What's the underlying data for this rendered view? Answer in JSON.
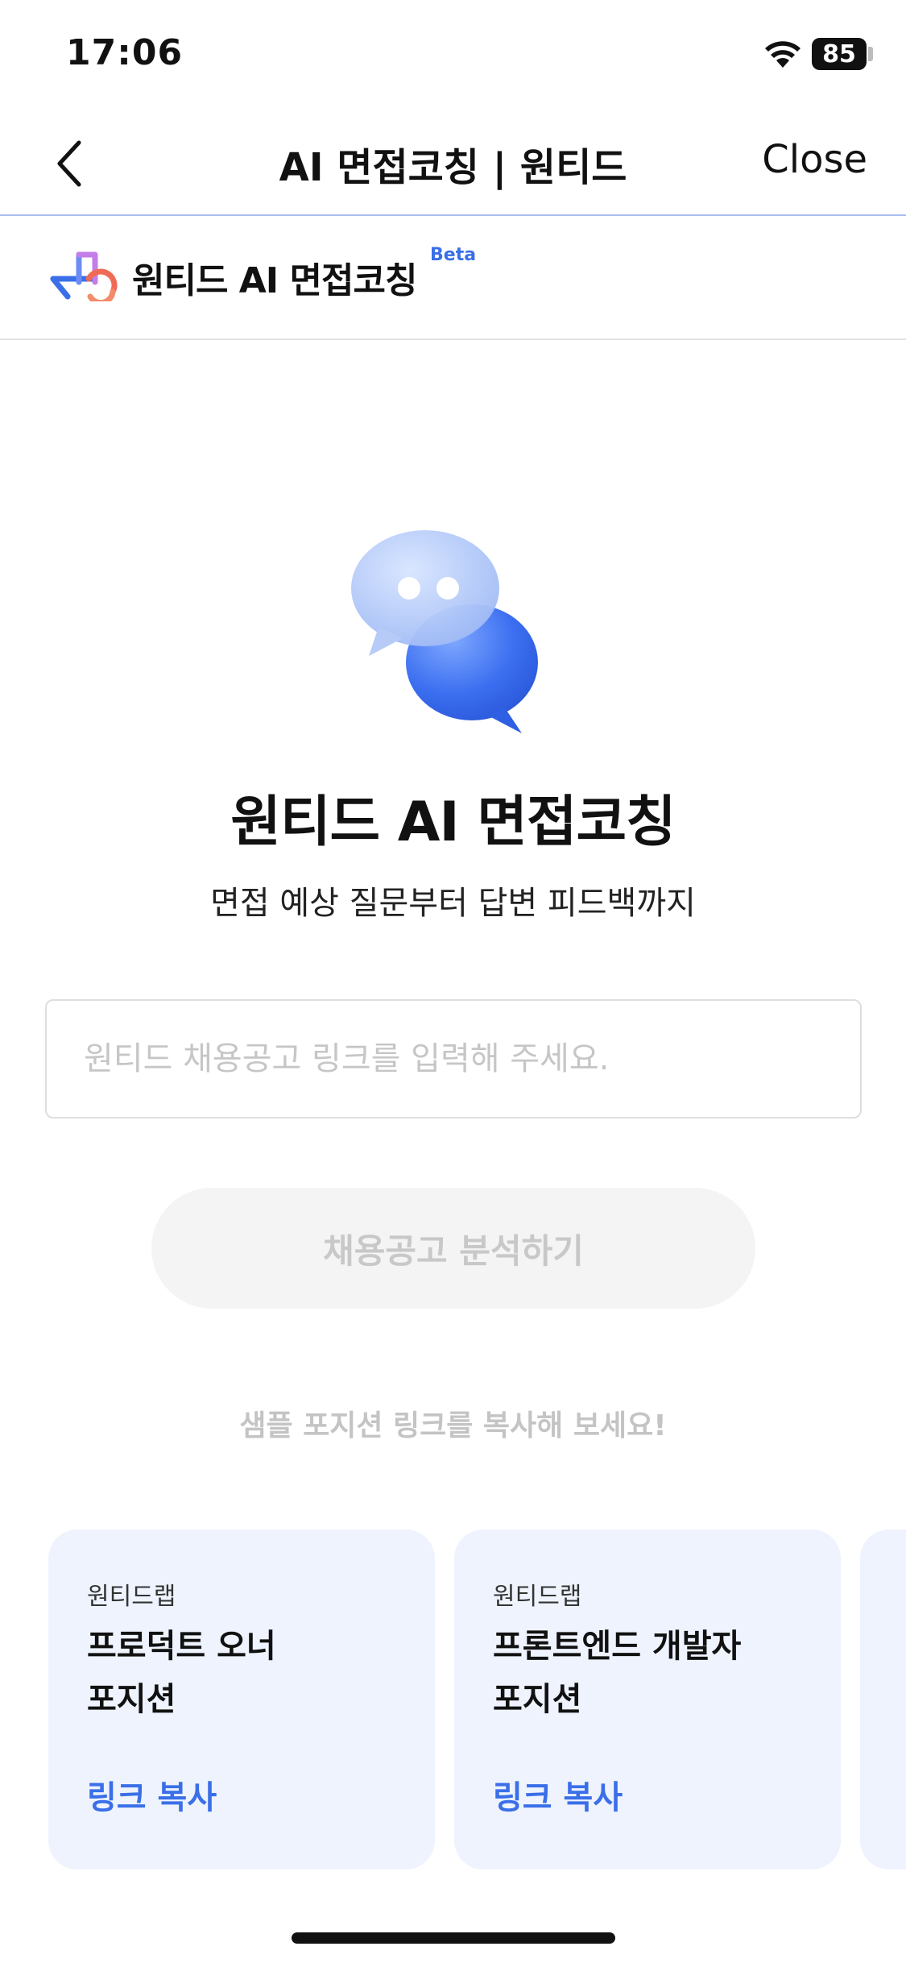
{
  "status_bar": {
    "time": "17:06",
    "battery": "85"
  },
  "nav": {
    "title": "AI 면접코칭 | 원티드",
    "close_label": "Close"
  },
  "brand": {
    "name": "원티드 AI 면접코칭",
    "badge": "Beta"
  },
  "hero": {
    "title": "원티드 AI 면접코칭",
    "subtitle": "면접 예상 질문부터 답변 피드백까지"
  },
  "link_input": {
    "placeholder": "원티드 채용공고 링크를 입력해 주세요.",
    "value": ""
  },
  "analyze_button": {
    "label": "채용공고 분석하기"
  },
  "sample_hint": "샘플 포지션 링크를 복사해 보세요!",
  "sample_cards": [
    {
      "company": "원티드랩",
      "role_line1": "프로덕트 오너",
      "role_line2": "포지션",
      "copy_label": "링크 복사"
    },
    {
      "company": "원티드랩",
      "role_line1": "프론트엔드 개발자",
      "role_line2": "포지션",
      "copy_label": "링크 복사"
    }
  ],
  "colors": {
    "accent": "#3a6fe8",
    "card_bg": "#eef3fd",
    "button_disabled_bg": "#f4f4f4"
  },
  "icons": {
    "back": "chevron-left-icon",
    "wifi": "wifi-icon",
    "chat": "chat-bubbles-icon"
  }
}
